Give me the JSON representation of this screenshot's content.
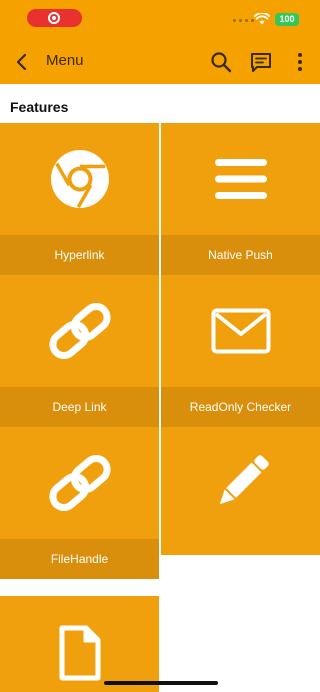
{
  "status": {
    "battery": "100"
  },
  "appbar": {
    "title": "Menu"
  },
  "section": {
    "title": "Features"
  },
  "tiles": [
    {
      "label": "Hyperlink",
      "icon": "chrome-icon"
    },
    {
      "label": "Native Push",
      "icon": "menu-lines-icon"
    },
    {
      "label": "Deep Link",
      "icon": "link-icon"
    },
    {
      "label": "ReadOnly Checker",
      "icon": "mail-icon"
    },
    {
      "label": "FileHandle",
      "icon": "link-icon"
    },
    {
      "label": "",
      "icon": "pencil-icon"
    },
    {
      "label": "",
      "icon": "file-icon"
    }
  ],
  "colors": {
    "accent": "#F5A100",
    "tile": "#F0A00C",
    "tile_label": "#D98F0B"
  }
}
